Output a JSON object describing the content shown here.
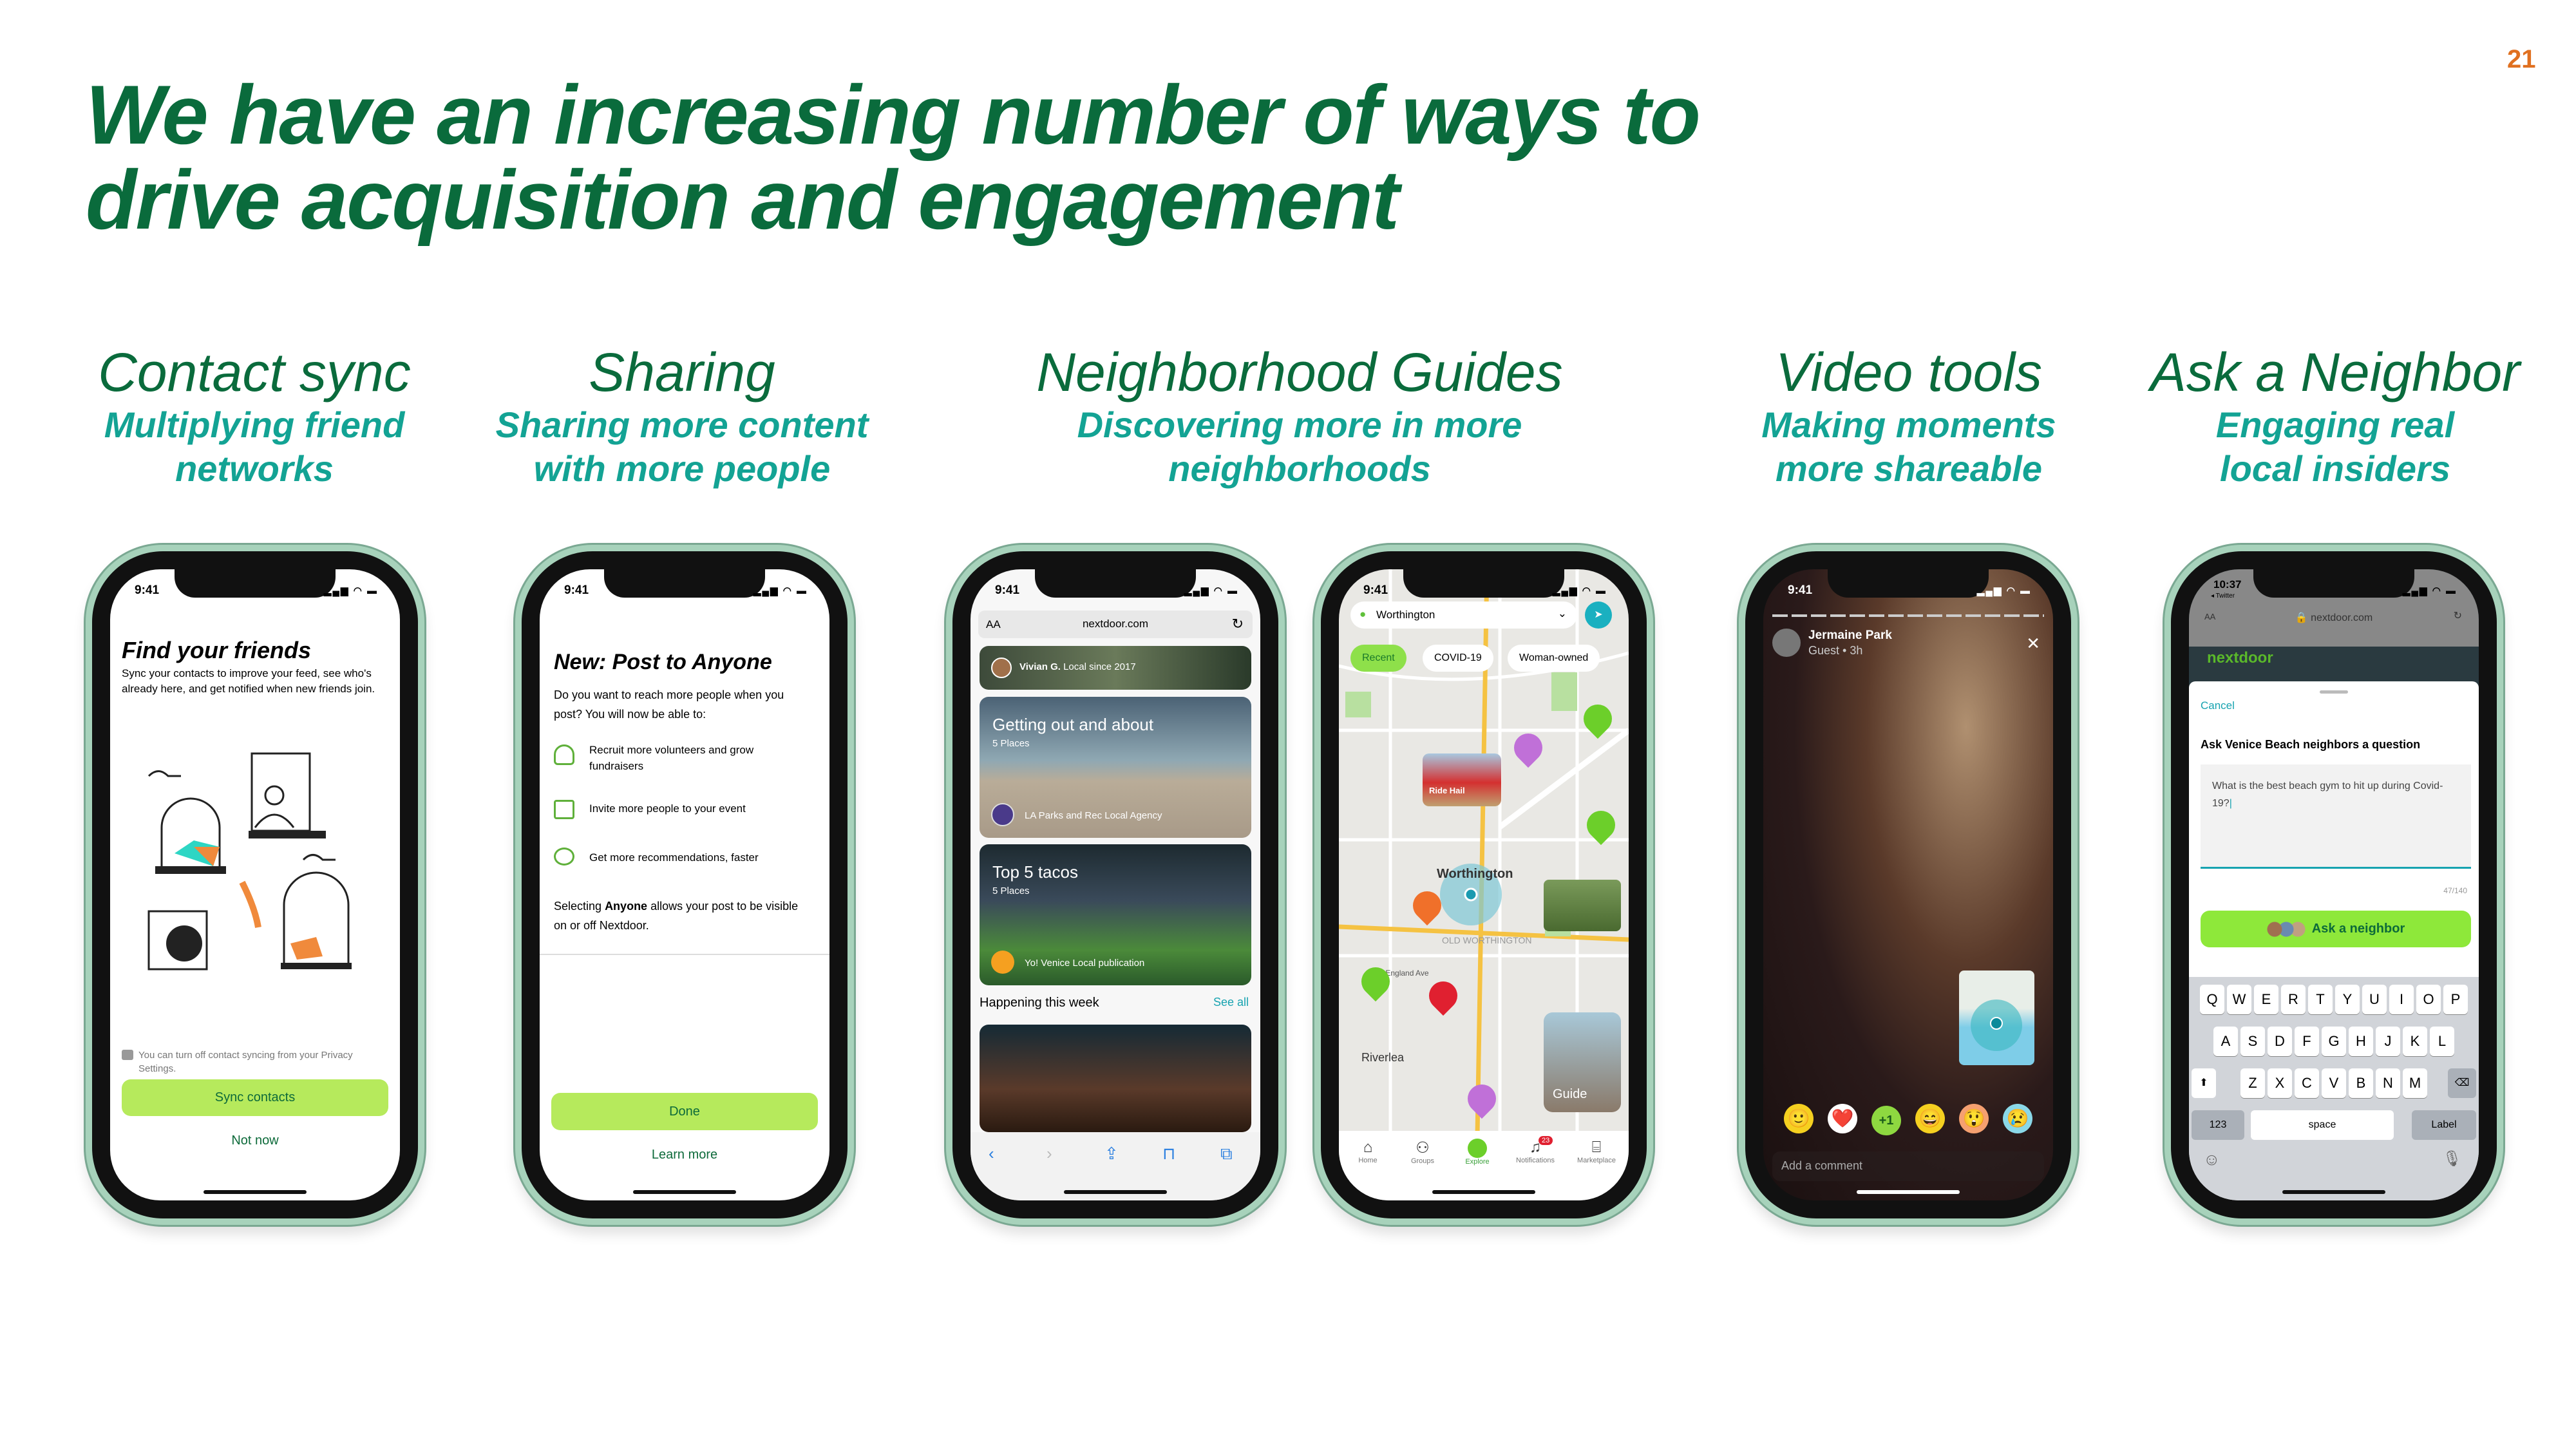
{
  "page_number": "21",
  "title": {
    "line1": "We have an increasing number of ways to",
    "line2": "drive acquisition and engagement"
  },
  "features": [
    {
      "heading": "Contact sync",
      "sub1": "Multiplying friend",
      "sub2": "networks"
    },
    {
      "heading": "Sharing",
      "sub1": "Sharing more content",
      "sub2": "with more people"
    },
    {
      "heading": "Neighborhood Guides",
      "sub1": "Discovering more in more",
      "sub2": "neighborhoods"
    },
    {
      "heading": "Video tools",
      "sub1": "Making moments",
      "sub2": "more shareable"
    },
    {
      "heading": "Ask a Neighbor",
      "sub1": "Engaging real",
      "sub2": "local insiders"
    }
  ],
  "colors": {
    "title": "#0a6b3c",
    "subtitle": "#13a394",
    "accent_button": "#b6ea5c",
    "page_number": "#e07020"
  },
  "status_time": "9:41",
  "phone1": {
    "title": "Find your friends",
    "body": "Sync your contacts to improve your feed, see who's already here, and get notified when new friends join.",
    "privacy_note": "You can turn off contact syncing from your Privacy Settings.",
    "primary": "Sync contacts",
    "secondary": "Not now",
    "icon": "lock-icon"
  },
  "phone2": {
    "title": "New: Post to Anyone",
    "body": "Do you want to reach more people when you post? You will now be able to:",
    "items": [
      {
        "icon": "volunteer-icon",
        "label": "Recruit more volunteers and grow fundraisers"
      },
      {
        "icon": "calendar-icon",
        "label": "Invite more people to your event"
      },
      {
        "icon": "chat-bubble-icon",
        "label": "Get more recommendations, faster"
      }
    ],
    "note_pre": "Selecting ",
    "note_bold": "Anyone",
    "note_post": " allows your post to be visible on or off Nextdoor.",
    "primary": "Done",
    "secondary": "Learn more"
  },
  "phone3": {
    "text_size": "AA",
    "url": "nextdoor.com",
    "author": "Vivian G.",
    "author_meta": "Local since 2017",
    "cards": [
      {
        "title": "Getting out and about",
        "count": "5 Places",
        "source": "LA Parks and Rec Local Agency"
      },
      {
        "title": "Top 5 tacos",
        "count": "5 Places",
        "source": "Yo! Venice Local publication"
      }
    ],
    "section": "Happening this week",
    "see_all": "See all"
  },
  "phone4": {
    "location": "Worthington",
    "chips": [
      "Recent",
      "COVID-19",
      "Woman-owned"
    ],
    "map_labels": [
      "Worthington",
      "OLD WORTHINGTON",
      "Riverlea",
      "New England Ave",
      "Ride Hail",
      "Guide"
    ],
    "tabs": [
      "Home",
      "Groups",
      "Explore",
      "Notifications",
      "Marketplace"
    ],
    "active_tab": "Explore",
    "notification_count": "23"
  },
  "phone5": {
    "user": "Jermaine Park",
    "meta": "Guest • 3h",
    "reactions": [
      "🙂",
      "❤️",
      "+1",
      "😄",
      "😲",
      "😢"
    ],
    "comment_placeholder": "Add a comment"
  },
  "phone6": {
    "time": "10:37",
    "back": "◂ Twitter",
    "text_size": "AA",
    "url": "nextdoor.com",
    "brand": "nextdoor",
    "cancel": "Cancel",
    "prompt": "Ask Venice Beach neighbors a question",
    "question": "What is the best beach gym to hit up during Covid-19?",
    "count": "47/140",
    "button": "Ask a neighbor",
    "keys": [
      [
        "Q",
        "W",
        "E",
        "R",
        "T",
        "Y",
        "U",
        "I",
        "O",
        "P"
      ],
      [
        "A",
        "S",
        "D",
        "F",
        "G",
        "H",
        "J",
        "K",
        "L"
      ],
      [
        "Z",
        "X",
        "C",
        "V",
        "B",
        "N",
        "M"
      ]
    ],
    "key_123": "123",
    "key_space": "space",
    "key_return": "Label"
  }
}
